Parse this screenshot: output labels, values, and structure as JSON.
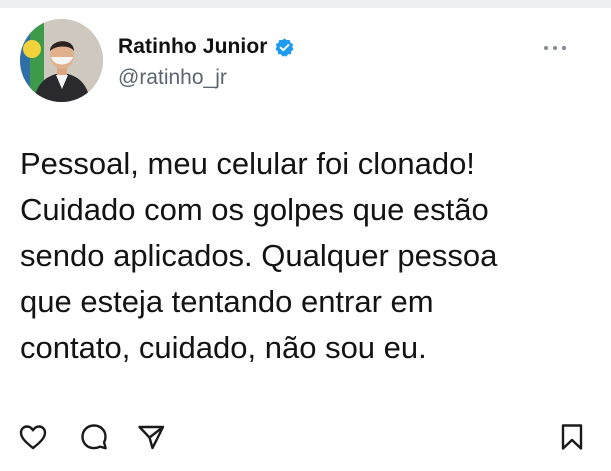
{
  "profile": {
    "display_name": "Ratinho Junior",
    "handle": "@ratinho_jr",
    "verified": true,
    "verified_color": "#1d9bf0"
  },
  "tweet": {
    "lines": [
      "Pessoal, meu celular foi clonado!",
      "Cuidado com os golpes que estão",
      "sendo aplicados. Qualquer pessoa",
      "que esteja tentando entrar em",
      "contato, cuidado, não sou eu."
    ]
  },
  "actions": {
    "icons": [
      "heart-icon",
      "comment-icon",
      "share-icon",
      "bookmark-icon"
    ]
  },
  "icons": {
    "more": "more-options-icon",
    "avatar": "profile-photo"
  }
}
